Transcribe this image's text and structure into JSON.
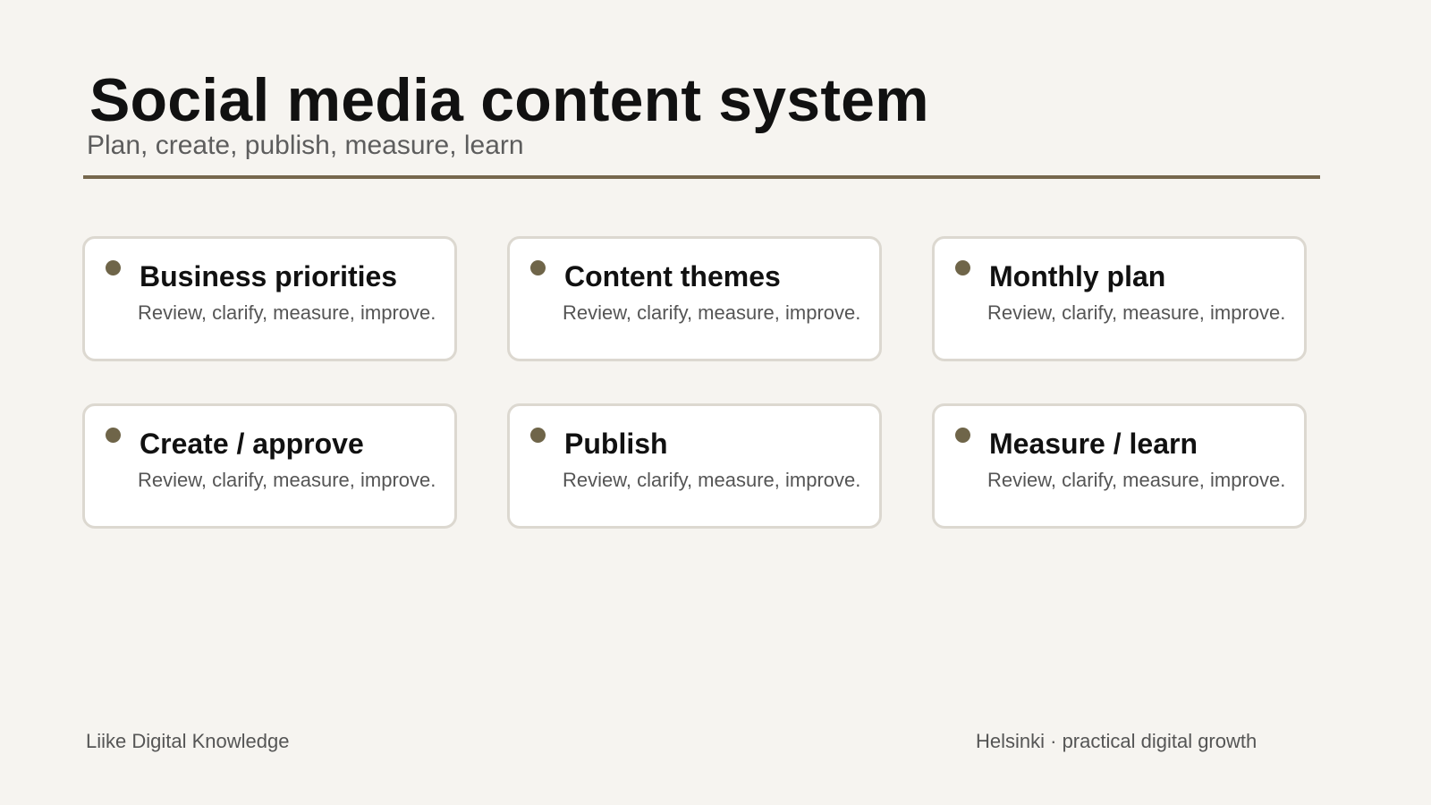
{
  "header": {
    "title": "Social media content system",
    "subtitle": "Plan, create, publish, measure, learn"
  },
  "accent_color": "#76674d",
  "cards": [
    {
      "title": "Business priorities",
      "description": "Review, clarify, measure, improve."
    },
    {
      "title": "Content themes",
      "description": "Review, clarify, measure, improve."
    },
    {
      "title": "Monthly plan",
      "description": "Review, clarify, measure, improve."
    },
    {
      "title": "Create / approve",
      "description": "Review, clarify, measure, improve."
    },
    {
      "title": "Publish",
      "description": "Review, clarify, measure, improve."
    },
    {
      "title": "Measure / learn",
      "description": "Review, clarify, measure, improve."
    }
  ],
  "footer": {
    "left": "Liike Digital Knowledge",
    "right": "Helsinki · practical digital growth"
  }
}
